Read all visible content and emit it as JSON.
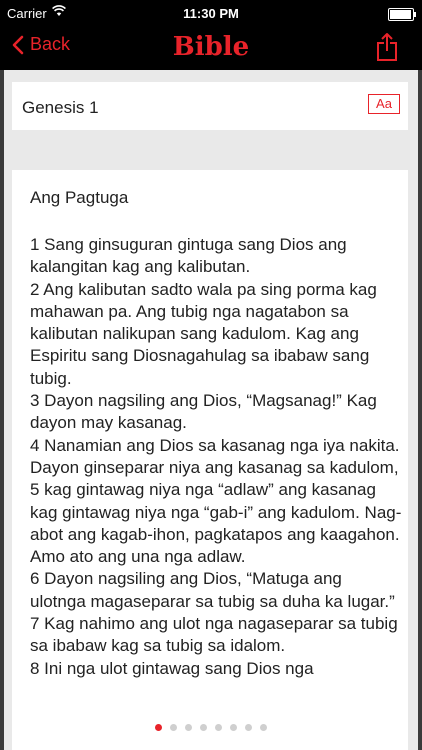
{
  "status_bar": {
    "carrier": "Carrier",
    "time": "11:30 PM",
    "battery_level": 0.95
  },
  "nav": {
    "back_label": "Back",
    "title": "Bible",
    "back_icon": "chevron-left-icon",
    "share_icon": "share-icon"
  },
  "chapter": {
    "label": "Genesis 1",
    "font_button_label": "Aa"
  },
  "reading": {
    "heading": "Ang Pagtuga",
    "verses": [
      "1 Sang ginsuguran gintuga sang Dios ang kalangitan kag ang kalibutan.",
      "2 Ang kalibutan sadto wala pa sing porma kag mahawan pa. Ang tubig nga nagatabon sa kalibutan nalikupan sang kadulom. Kag ang Espiritu sang Diosnagahulag sa ibabaw sang tubig.",
      "3 Dayon nagsiling ang Dios, “Magsanag!” Kag dayon may kasanag.",
      "4 Nanamian ang Dios sa kasanag nga iya nakita. Dayon ginseparar niya ang kasanag sa kadulom,",
      "5 kag gintawag niya nga “adlaw” ang kasanag kag gintawag niya nga “gab-i” ang kadulom. Nag-abot ang kagab-ihon, pagkatapos ang kaagahon. Amo ato ang una nga adlaw.",
      "6 Dayon nagsiling ang Dios, “Matuga ang ulotnga magaseparar sa tubig sa duha ka lugar.”",
      "7 Kag nahimo ang ulot nga nagaseparar sa tubig sa ibabaw kag sa tubig sa idalom.",
      "8 Ini nga ulot gintawag sang Dios nga"
    ]
  },
  "pager": {
    "total": 8,
    "active_index": 0
  },
  "colors": {
    "accent": "#e8232a",
    "background": "#e9e9e9"
  }
}
